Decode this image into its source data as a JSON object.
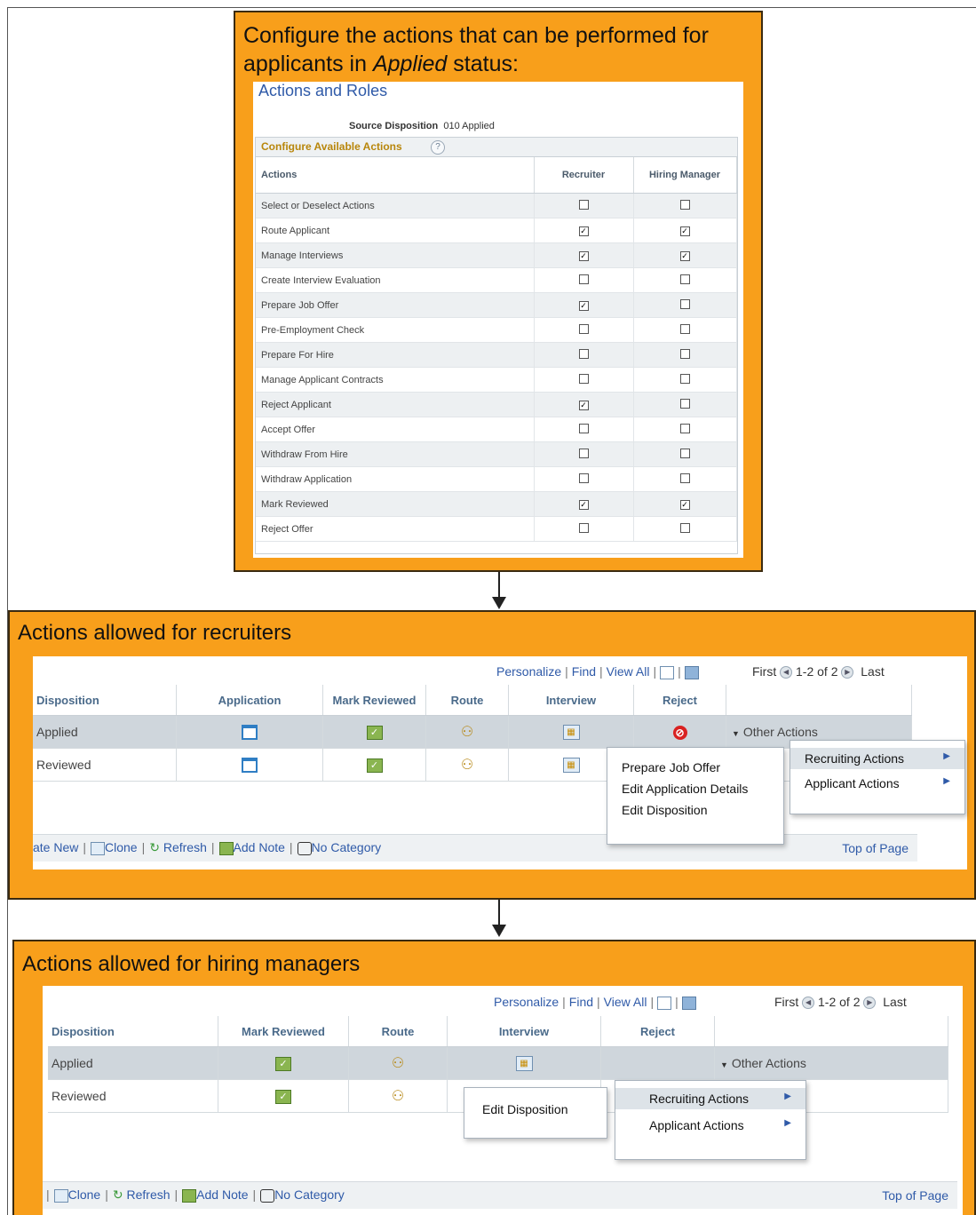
{
  "panel1": {
    "caption_line1": "Configure the actions that can be performed for",
    "caption_line2_pre": "applicants in ",
    "caption_line2_em": "Applied",
    "caption_line2_post": " status:",
    "page_title": "Actions and Roles",
    "source_disposition_label": "Source Disposition",
    "source_disposition_value": "010 Applied",
    "section_label": "Configure Available Actions",
    "columns": [
      "Actions",
      "Recruiter",
      "Hiring Manager"
    ],
    "rows": [
      {
        "action": "Select or Deselect Actions",
        "recruiter": false,
        "hiring_manager": false
      },
      {
        "action": "Route Applicant",
        "recruiter": true,
        "hiring_manager": true
      },
      {
        "action": "Manage Interviews",
        "recruiter": true,
        "hiring_manager": true
      },
      {
        "action": "Create Interview Evaluation",
        "recruiter": false,
        "hiring_manager": false
      },
      {
        "action": "Prepare Job Offer",
        "recruiter": true,
        "hiring_manager": false
      },
      {
        "action": "Pre-Employment Check",
        "recruiter": false,
        "hiring_manager": false
      },
      {
        "action": "Prepare For Hire",
        "recruiter": false,
        "hiring_manager": false
      },
      {
        "action": "Manage Applicant Contracts",
        "recruiter": false,
        "hiring_manager": false
      },
      {
        "action": "Reject Applicant",
        "recruiter": true,
        "hiring_manager": false
      },
      {
        "action": "Accept Offer",
        "recruiter": false,
        "hiring_manager": false
      },
      {
        "action": "Withdraw From Hire",
        "recruiter": false,
        "hiring_manager": false
      },
      {
        "action": "Withdraw Application",
        "recruiter": false,
        "hiring_manager": false
      },
      {
        "action": "Mark Reviewed",
        "recruiter": true,
        "hiring_manager": true
      },
      {
        "action": "Reject Offer",
        "recruiter": false,
        "hiring_manager": false
      }
    ]
  },
  "panel2": {
    "caption": "Actions allowed for recruiters",
    "toolbar": {
      "personalize": "Personalize",
      "find": "Find",
      "view_all": "View All"
    },
    "pager": {
      "first": "First",
      "range": "1-2 of 2",
      "last": "Last"
    },
    "columns": [
      "Disposition",
      "Application",
      "Mark Reviewed",
      "Route",
      "Interview",
      "Reject"
    ],
    "rows": [
      {
        "disposition": "Applied",
        "other": "Other Actions"
      },
      {
        "disposition": "Reviewed",
        "other": ""
      }
    ],
    "menu_main": [
      "Recruiting Actions",
      "Applicant Actions"
    ],
    "menu_sub": [
      "Prepare Job Offer",
      "Edit Application Details",
      "Edit Disposition"
    ],
    "footer": {
      "create_new": "ate New",
      "clone": "Clone",
      "refresh": "Refresh",
      "add_note": "Add Note",
      "no_category": "No Category",
      "top": "Top of Page"
    }
  },
  "panel3": {
    "caption": "Actions allowed for hiring managers",
    "toolbar": {
      "personalize": "Personalize",
      "find": "Find",
      "view_all": "View All"
    },
    "pager": {
      "first": "First",
      "range": "1-2 of 2",
      "last": "Last"
    },
    "columns": [
      "Disposition",
      "Mark Reviewed",
      "Route",
      "Interview",
      "Reject"
    ],
    "rows": [
      {
        "disposition": "Applied",
        "other": "Other Actions"
      },
      {
        "disposition": "Reviewed",
        "other": ""
      }
    ],
    "menu_main": [
      "Recruiting Actions",
      "Applicant Actions"
    ],
    "menu_sub": [
      "Edit Disposition"
    ],
    "footer": {
      "clone": "Clone",
      "refresh": "Refresh",
      "add_note": "Add Note",
      "no_category": "No Category",
      "top": "Top of Page"
    }
  },
  "colors": {
    "orange": "#f89f1b",
    "link": "#2f5aa8",
    "section_gold": "#b8860b"
  },
  "icons": [
    "application-icon",
    "mark-reviewed-icon",
    "route-icon",
    "interview-icon",
    "reject-icon",
    "clone-icon",
    "refresh-icon",
    "add-note-icon",
    "no-category-icon",
    "help-icon",
    "chevron-right-icon"
  ]
}
